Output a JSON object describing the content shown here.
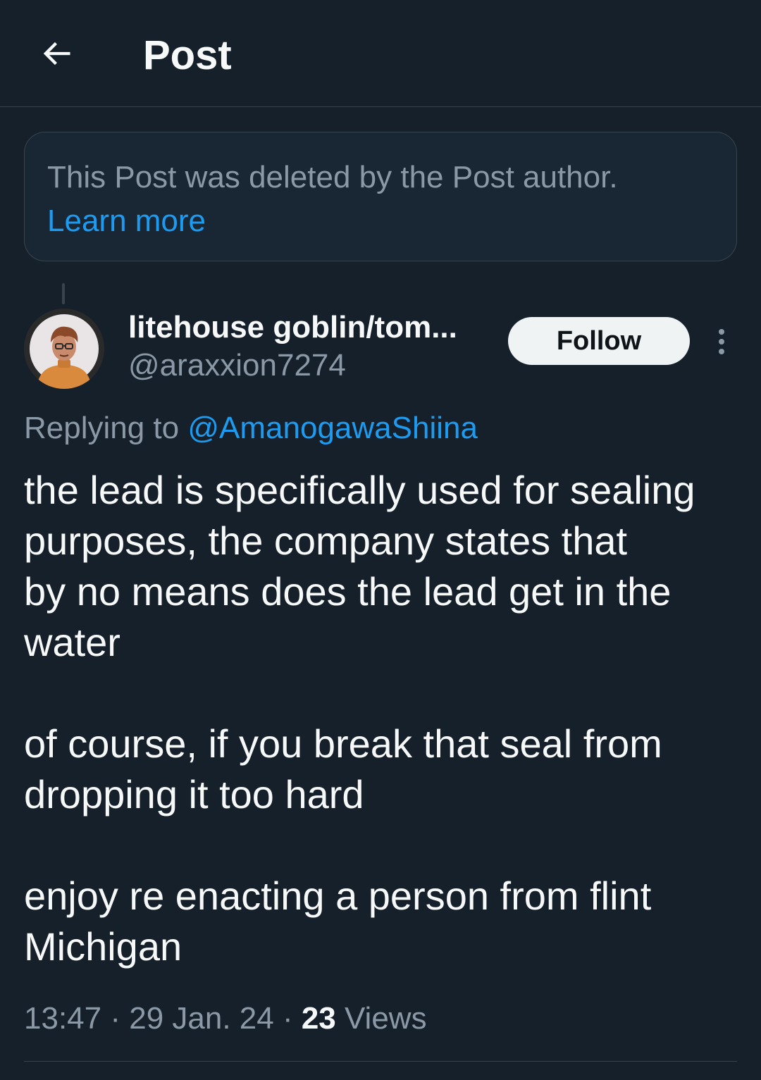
{
  "header": {
    "title": "Post",
    "back_icon": "arrow-left-icon"
  },
  "notice": {
    "text": "This Post was deleted by the Post author.",
    "link_text": "Learn more"
  },
  "post": {
    "author": {
      "display_name": "litehouse goblin/tom...",
      "handle": "@araxxion7274"
    },
    "follow_label": "Follow",
    "more_icon": "more-vertical-icon",
    "replying_prefix": "Replying to ",
    "replying_to": "@AmanogawaShiina",
    "paragraphs": [
      {
        "lines": [
          "the lead is specifically used for sealing",
          "purposes, the company states that",
          "by no means does the lead get in the",
          "water"
        ]
      },
      {
        "lines": [
          "of course, if you break that seal from",
          "dropping it too hard"
        ]
      },
      {
        "lines": [
          "enjoy re enacting a person from flint",
          "Michigan"
        ]
      }
    ],
    "time": "13:47",
    "date": "29 Jan. 24",
    "separator": " · ",
    "views_count": "23",
    "views_label": " Views"
  },
  "colors": {
    "background": "#15202b",
    "text_primary": "#f7f9f9",
    "text_secondary": "#8b98a5",
    "accent": "#1d9bf0",
    "border": "#38444d"
  }
}
